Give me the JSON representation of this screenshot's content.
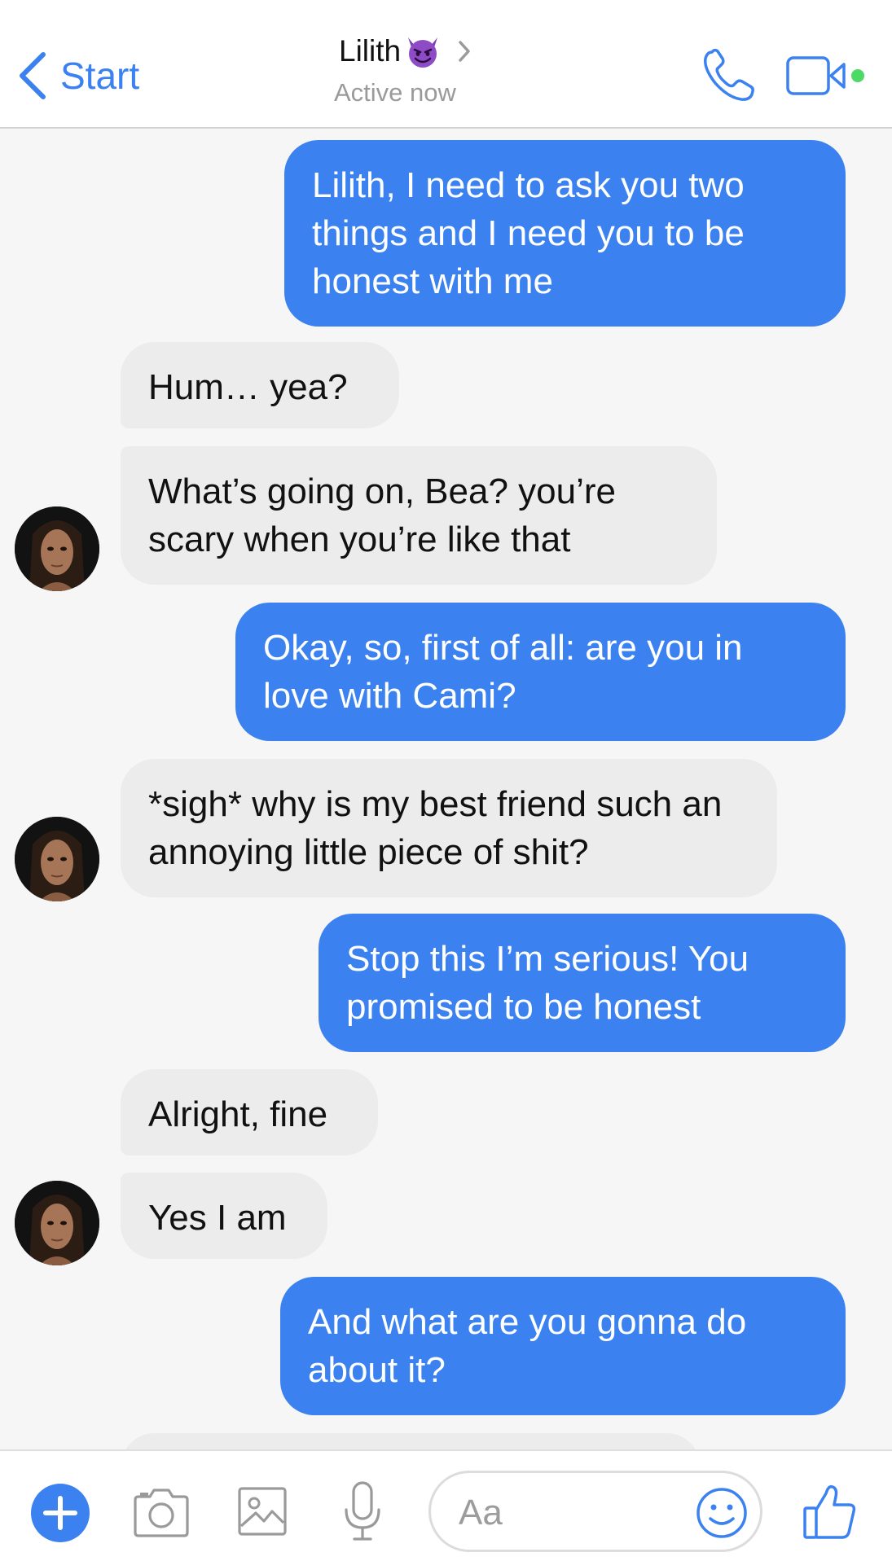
{
  "header": {
    "back_label": "Start",
    "contact_name": "Lilith",
    "status": "Active now",
    "accent_color": "#3b82f0",
    "online_color": "#4cd964",
    "icons": [
      "chevron-left-icon",
      "devil-emoji-icon",
      "chevron-right-icon",
      "phone-icon",
      "video-camera-icon"
    ]
  },
  "messages": [
    {
      "direction": "outgoing",
      "text": "Lilith, I need to ask you two things and I need you to be honest with me"
    },
    {
      "direction": "incoming",
      "text": "Hum… yea?"
    },
    {
      "direction": "incoming",
      "text": "What’s going on, Bea? you’re scary when you’re like that",
      "avatar": true
    },
    {
      "direction": "outgoing",
      "text": "Okay, so, first of all: are you in love with Cami?"
    },
    {
      "direction": "incoming",
      "text": "*sigh* why is my best friend such an annoying little piece of shit?",
      "avatar": true
    },
    {
      "direction": "outgoing",
      "text": "Stop this I’m serious! You promised to be honest"
    },
    {
      "direction": "incoming",
      "text": "Alright, fine"
    },
    {
      "direction": "incoming",
      "text": "Yes I am",
      "avatar": true
    },
    {
      "direction": "outgoing",
      "text": "And what are you gonna do about it?"
    }
  ],
  "composer": {
    "placeholder": "Aa",
    "icons": [
      "plus-icon",
      "camera-icon",
      "image-icon",
      "microphone-icon",
      "smiley-icon",
      "thumbs-up-icon"
    ]
  },
  "colors": {
    "outgoing_bubble": "#3b82f0",
    "incoming_bubble": "#ececec",
    "background": "#f6f6f6"
  }
}
